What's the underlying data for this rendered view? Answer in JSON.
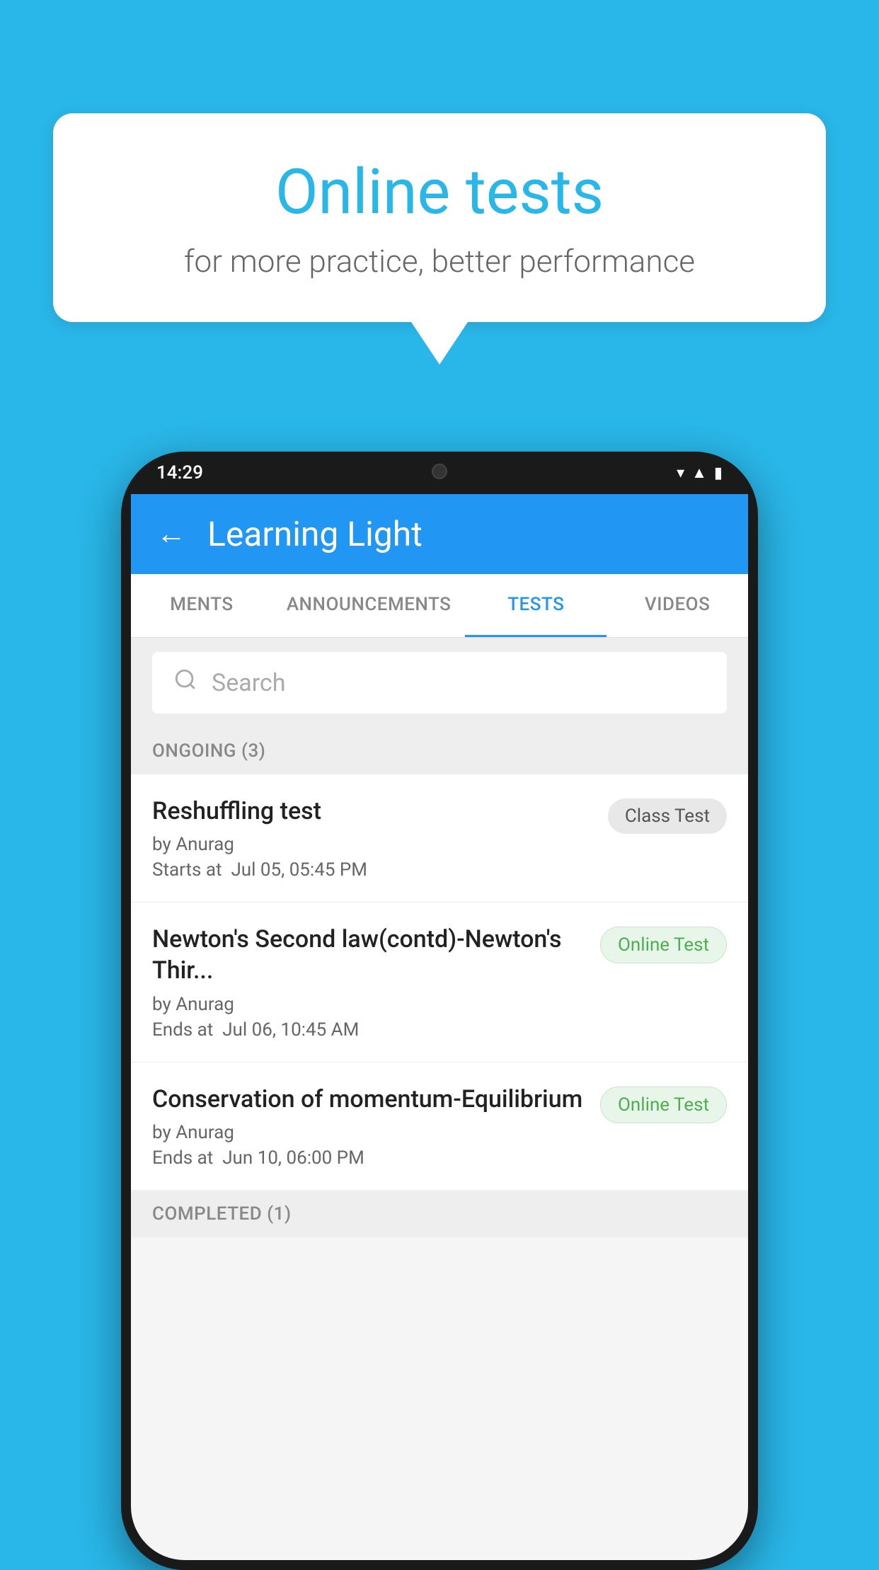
{
  "background_color": "#29b6e8",
  "speech_bubble": {
    "title": "Online tests",
    "subtitle": "for more practice, better performance"
  },
  "phone": {
    "status_bar": {
      "time": "14:29"
    },
    "app_header": {
      "back_label": "←",
      "title": "Learning Light"
    },
    "tabs": [
      {
        "label": "MENTS",
        "active": false
      },
      {
        "label": "ANNOUNCEMENTS",
        "active": false
      },
      {
        "label": "TESTS",
        "active": true
      },
      {
        "label": "VIDEOS",
        "active": false
      }
    ],
    "search": {
      "placeholder": "Search"
    },
    "ongoing_section": {
      "header": "ONGOING (3)",
      "items": [
        {
          "name": "Reshuffling test",
          "author": "by Anurag",
          "time_label": "Starts at",
          "time": "Jul 05, 05:45 PM",
          "badge": "Class Test",
          "badge_type": "class"
        },
        {
          "name": "Newton's Second law(contd)-Newton's Thir...",
          "author": "by Anurag",
          "time_label": "Ends at",
          "time": "Jul 06, 10:45 AM",
          "badge": "Online Test",
          "badge_type": "online"
        },
        {
          "name": "Conservation of momentum-Equilibrium",
          "author": "by Anurag",
          "time_label": "Ends at",
          "time": "Jun 10, 06:00 PM",
          "badge": "Online Test",
          "badge_type": "online"
        }
      ]
    },
    "completed_section": {
      "header": "COMPLETED (1)"
    }
  }
}
